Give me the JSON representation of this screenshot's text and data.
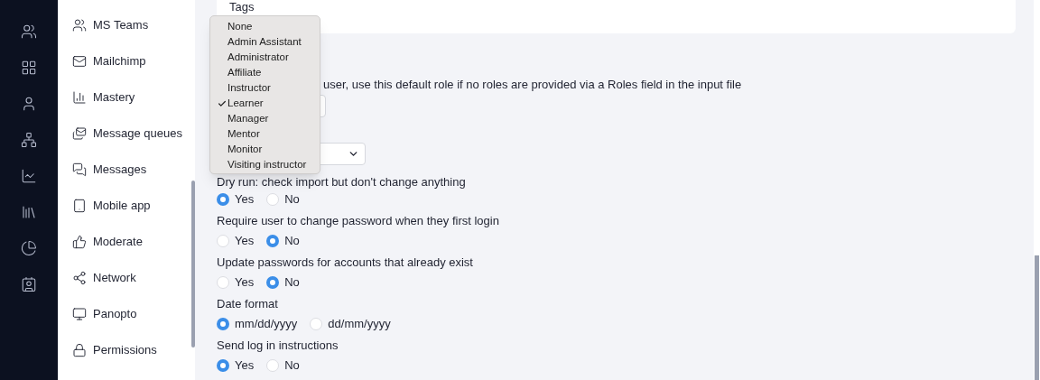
{
  "sidebar": {
    "items": [
      {
        "label": "MS Teams"
      },
      {
        "label": "Mailchimp"
      },
      {
        "label": "Mastery"
      },
      {
        "label": "Message queues"
      },
      {
        "label": "Messages"
      },
      {
        "label": "Mobile app"
      },
      {
        "label": "Moderate"
      },
      {
        "label": "Network"
      },
      {
        "label": "Panopto"
      },
      {
        "label": "Permissions"
      }
    ]
  },
  "tags_card": {
    "label": "Tags"
  },
  "role_hint": "user, use this default role if no roles are provided via a Roles field in the input file",
  "role_dropdown": {
    "options": [
      {
        "label": "None",
        "selected": false
      },
      {
        "label": "Admin Assistant",
        "selected": false
      },
      {
        "label": "Administrator",
        "selected": false
      },
      {
        "label": "Affiliate",
        "selected": false
      },
      {
        "label": "Instructor",
        "selected": false
      },
      {
        "label": "Learner",
        "selected": true
      },
      {
        "label": "Manager",
        "selected": false
      },
      {
        "label": "Mentor",
        "selected": false
      },
      {
        "label": "Monitor",
        "selected": false
      },
      {
        "label": "Visiting instructor",
        "selected": false
      }
    ]
  },
  "radio_groups": [
    {
      "label": "Dry run: check import but don't change anything",
      "options": [
        {
          "label": "Yes",
          "selected": true
        },
        {
          "label": "No",
          "selected": false
        }
      ]
    },
    {
      "label": "Require user to change password when they first login",
      "options": [
        {
          "label": "Yes",
          "selected": false
        },
        {
          "label": "No",
          "selected": true
        }
      ]
    },
    {
      "label": "Update passwords for accounts that already exist",
      "options": [
        {
          "label": "Yes",
          "selected": false
        },
        {
          "label": "No",
          "selected": true
        }
      ]
    },
    {
      "label": "Date format",
      "options": [
        {
          "label": "mm/dd/yyyy",
          "selected": true
        },
        {
          "label": "dd/mm/yyyy",
          "selected": false
        }
      ]
    },
    {
      "label": "Send log in instructions",
      "options": [
        {
          "label": "Yes",
          "selected": true
        },
        {
          "label": "No",
          "selected": false
        }
      ]
    }
  ]
}
